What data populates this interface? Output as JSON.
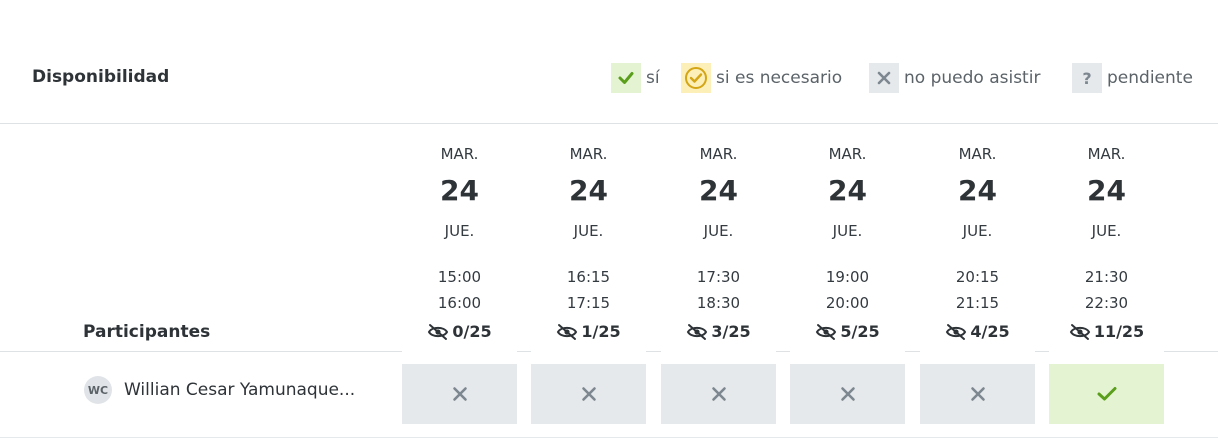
{
  "header": {
    "title": "Disponibilidad"
  },
  "legend": {
    "yes": "sí",
    "if_needed": "si es necesario",
    "cannot": "no puedo asistir",
    "pending": "pendiente",
    "pending_symbol": "?"
  },
  "participants_label": "Participantes",
  "columns": [
    {
      "month": "MAR.",
      "day": "24",
      "weekday": "JUE.",
      "start": "15:00",
      "end": "16:00",
      "count": "0/25"
    },
    {
      "month": "MAR.",
      "day": "24",
      "weekday": "JUE.",
      "start": "16:15",
      "end": "17:15",
      "count": "1/25"
    },
    {
      "month": "MAR.",
      "day": "24",
      "weekday": "JUE.",
      "start": "17:30",
      "end": "18:30",
      "count": "3/25"
    },
    {
      "month": "MAR.",
      "day": "24",
      "weekday": "JUE.",
      "start": "19:00",
      "end": "20:00",
      "count": "5/25"
    },
    {
      "month": "MAR.",
      "day": "24",
      "weekday": "JUE.",
      "start": "20:15",
      "end": "21:15",
      "count": "4/25"
    },
    {
      "month": "MAR.",
      "day": "24",
      "weekday": "JUE.",
      "start": "21:30",
      "end": "22:30",
      "count": "11/25"
    }
  ],
  "participant": {
    "initials": "WC",
    "name": "Willian Cesar Yamunaque...",
    "responses": [
      "no",
      "no",
      "no",
      "no",
      "no",
      "yes"
    ]
  },
  "colors": {
    "yes": "#5a9e1c",
    "if_needed": "#d4a514",
    "no": "#7d8790"
  }
}
